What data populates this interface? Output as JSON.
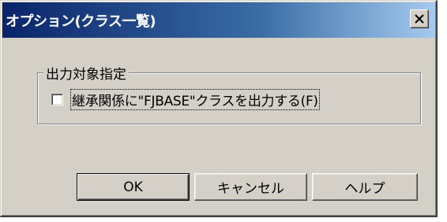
{
  "window": {
    "title": "オプション(クラス一覧)",
    "close_label": "×"
  },
  "group": {
    "legend": "出力対象指定",
    "checkbox": {
      "label": "継承関係に\"FJBASE\"クラスを出力する(F)",
      "checked": false
    }
  },
  "buttons": {
    "ok": "OK",
    "cancel": "キャンセル",
    "help": "ヘルプ"
  },
  "colors": {
    "face": "#d4d0c8",
    "title_start": "#0a246a",
    "title_end": "#a6caf0"
  }
}
